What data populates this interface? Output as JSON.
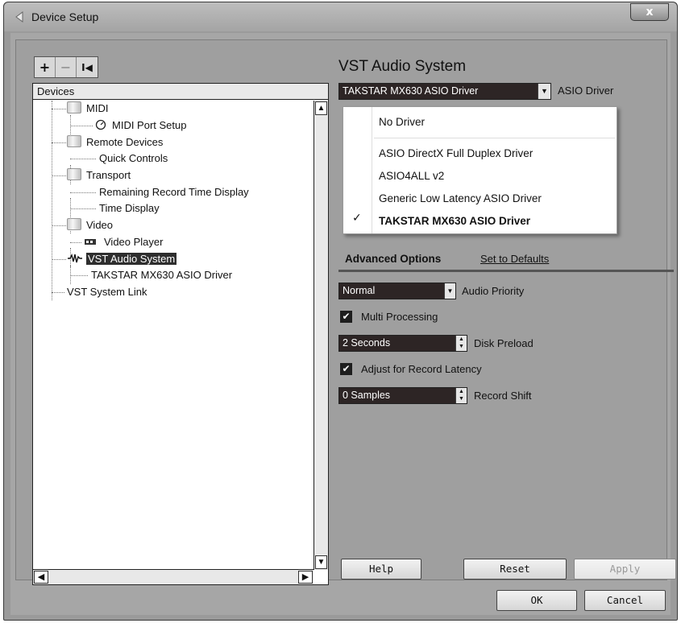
{
  "window": {
    "title": "Device Setup",
    "close_label": "x"
  },
  "toolbar": {
    "add": "+",
    "remove": "−",
    "reset": "I◀"
  },
  "devices": {
    "header": "Devices",
    "items": [
      {
        "label": "MIDI"
      },
      {
        "label": "MIDI Port Setup"
      },
      {
        "label": "Remote Devices"
      },
      {
        "label": "Quick Controls"
      },
      {
        "label": "Transport"
      },
      {
        "label": "Remaining Record Time Display"
      },
      {
        "label": "Time Display"
      },
      {
        "label": "Video"
      },
      {
        "label": "Video Player"
      },
      {
        "label": "VST Audio System"
      },
      {
        "label": "TAKSTAR MX630 ASIO Driver"
      },
      {
        "label": "VST System Link"
      }
    ],
    "selected": "VST Audio System"
  },
  "main": {
    "title": "VST Audio System",
    "driver_value": "TAKSTAR MX630 ASIO Driver",
    "driver_label": "ASIO Driver",
    "dropdown": {
      "options": [
        "No Driver",
        "ASIO DirectX Full Duplex Driver",
        "ASIO4ALL v2",
        "Generic Low Latency ASIO Driver",
        "TAKSTAR MX630 ASIO Driver"
      ],
      "checkmark": "✓"
    },
    "advanced": {
      "title": "Advanced Options",
      "defaults_link": "Set to Defaults",
      "audio_priority_value": "Normal",
      "audio_priority_label": "Audio Priority",
      "multi_processing_label": "Multi Processing",
      "multi_processing_checked": true,
      "disk_preload_value": "2 Seconds",
      "disk_preload_label": "Disk Preload",
      "adjust_latency_label": "Adjust for Record Latency",
      "adjust_latency_checked": true,
      "record_shift_value": "0 Samples",
      "record_shift_label": "Record Shift"
    },
    "buttons": {
      "help": "Help",
      "reset": "Reset",
      "apply": "Apply"
    }
  },
  "footer": {
    "ok": "OK",
    "cancel": "Cancel"
  }
}
